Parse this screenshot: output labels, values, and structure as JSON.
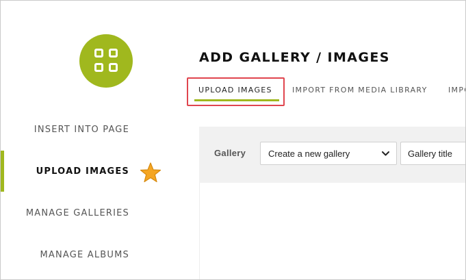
{
  "page_title": "ADD GALLERY / IMAGES",
  "sidebar": {
    "items": [
      {
        "label": "INSERT INTO PAGE",
        "active": false
      },
      {
        "label": "UPLOAD IMAGES",
        "active": true
      },
      {
        "label": "MANAGE GALLERIES",
        "active": false
      },
      {
        "label": "MANAGE ALBUMS",
        "active": false
      }
    ]
  },
  "tabs": [
    {
      "label": "UPLOAD IMAGES",
      "active": true
    },
    {
      "label": "IMPORT FROM MEDIA LIBRARY",
      "active": false
    },
    {
      "label": "IMPO",
      "active": false
    }
  ],
  "upload_form": {
    "gallery_label": "Gallery",
    "gallery_select_value": "Create a new gallery",
    "gallery_title_placeholder": "Gallery title"
  },
  "icons": {
    "logo": "grid-icon",
    "annotation": "star-icon",
    "dropdown": "chevron-down-icon"
  },
  "colors": {
    "accent": "#a0b81e",
    "highlight": "#e0454e",
    "star": "#f5a623"
  }
}
